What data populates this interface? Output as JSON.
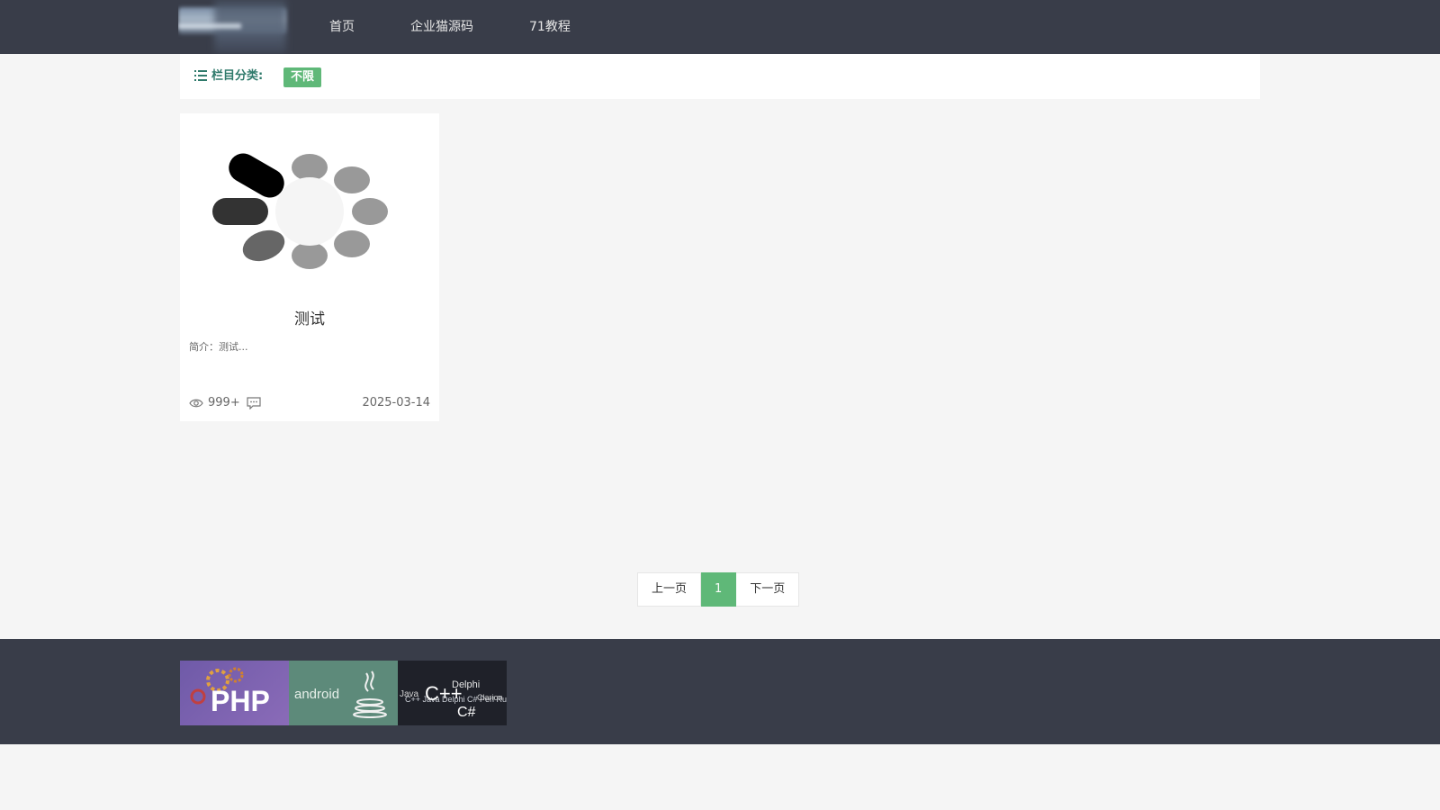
{
  "header": {
    "nav": [
      "首页",
      "企业猫源码",
      "71教程"
    ]
  },
  "category": {
    "label": "栏目分类:",
    "tag": "不限"
  },
  "cards": [
    {
      "title": "测试",
      "desc": "简介：测试...",
      "views": "999+",
      "date": "2025-03-14"
    }
  ],
  "pagination": {
    "prev": "上一页",
    "current": "1",
    "next": "下一页"
  },
  "footer": {
    "banners": [
      "PHP",
      "android",
      "C++ Java Delphi C# Perl Ruby Ada Action Script Clarion Object Dylan"
    ]
  },
  "colors": {
    "header_bg": "#393d49",
    "accent": "#5fb878",
    "page_bg": "#f5f5f5"
  }
}
